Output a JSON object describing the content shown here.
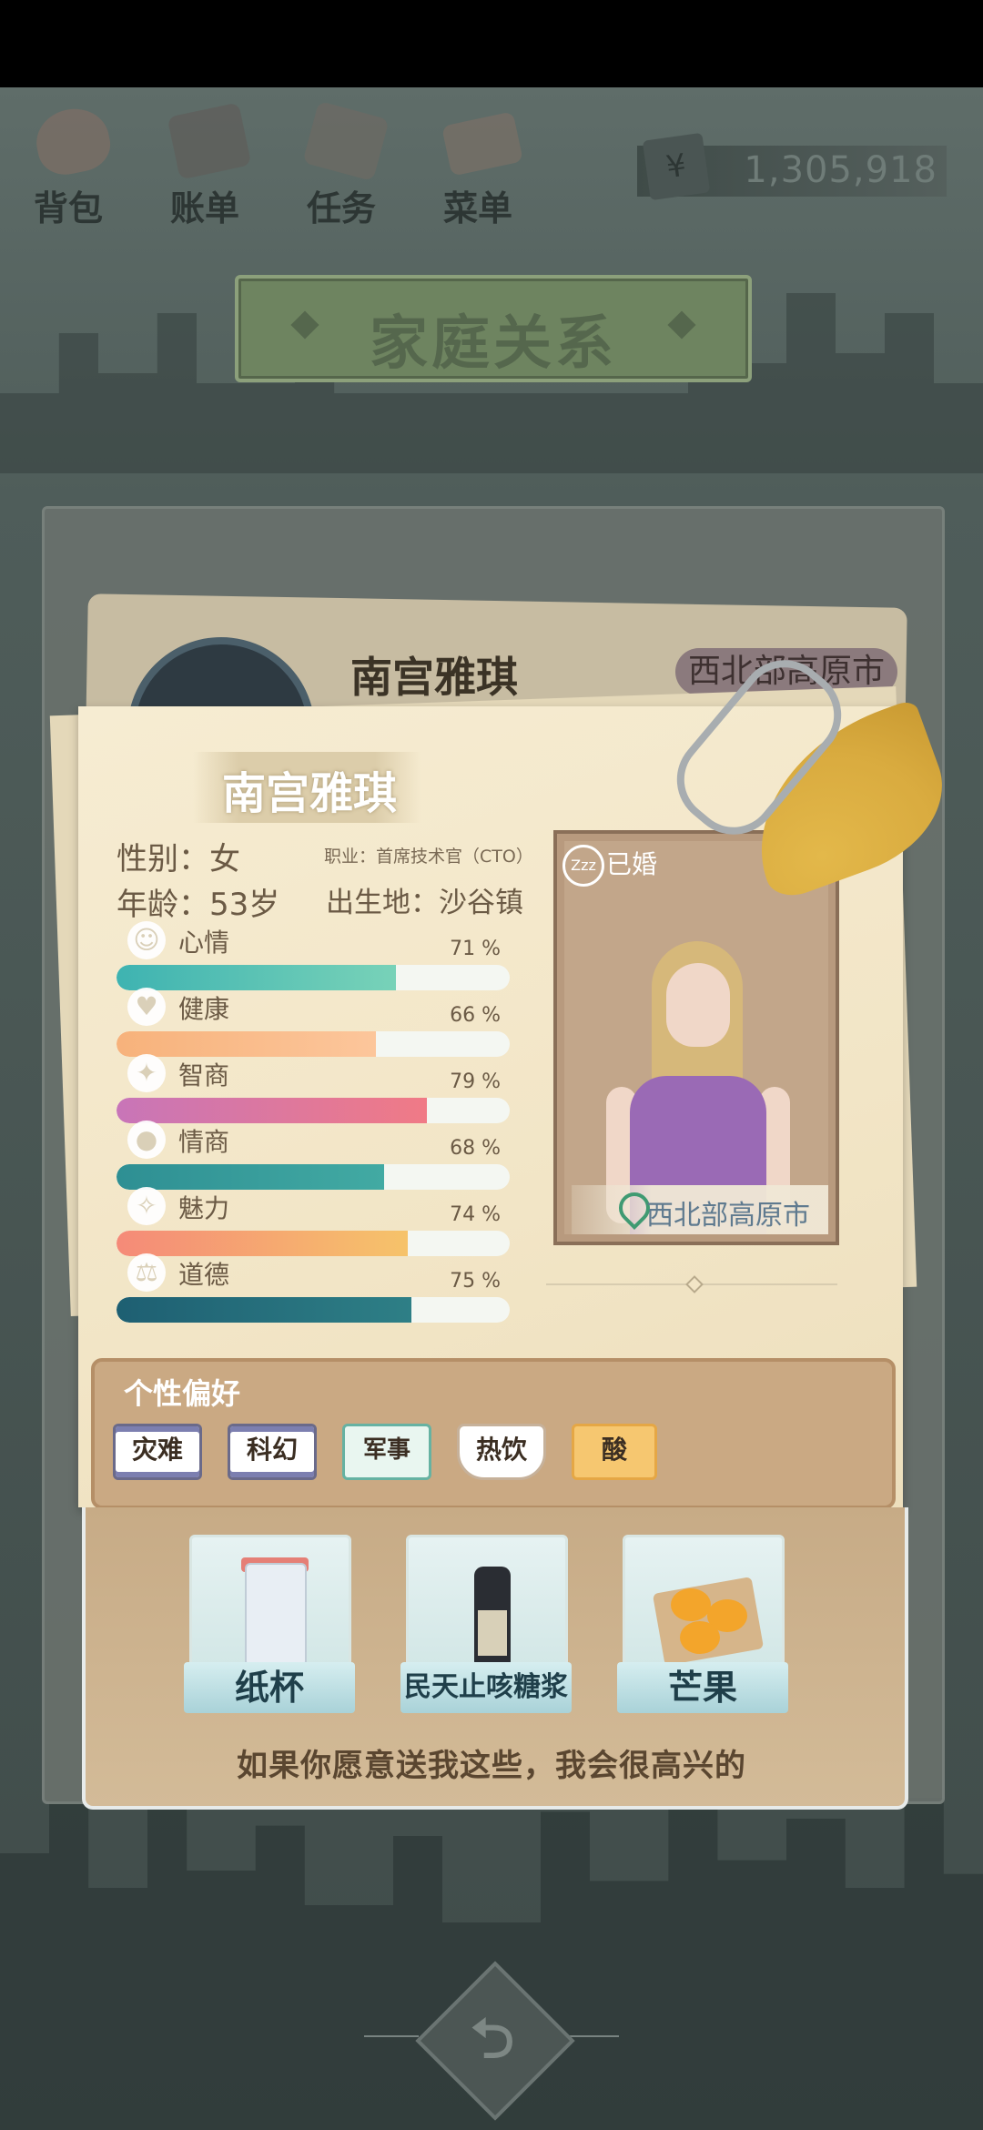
{
  "nav": {
    "items": [
      {
        "label": "背包",
        "icon": "backpack-icon"
      },
      {
        "label": "账单",
        "icon": "bill-icon"
      },
      {
        "label": "任务",
        "icon": "task-icon"
      },
      {
        "label": "菜单",
        "icon": "menu-icon"
      }
    ],
    "money_symbol": "¥",
    "money": "1,305,918"
  },
  "title": "家庭关系",
  "background_card": {
    "name": "南宫雅琪",
    "location": "西北部高原市"
  },
  "profile": {
    "name": "南宫雅琪",
    "gender": "性别：女",
    "job": "职业：首席技术官（CTO）",
    "age": "年龄：53岁",
    "birthplace": "出生地：沙谷镇",
    "marital_status": "已婚",
    "sleep_badge": "Zzz",
    "location": "西北部高原市"
  },
  "stats": [
    {
      "label": "心情",
      "pct_text": "71 %",
      "value": 0.71,
      "icon": "smile-icon",
      "glyph": "☺",
      "color": [
        "#3eb3b1",
        "#78d2b8"
      ]
    },
    {
      "label": "健康",
      "pct_text": "66 %",
      "value": 0.66,
      "icon": "heart-icon",
      "glyph": "♥",
      "color": [
        "#f7b27b",
        "#fcc69b"
      ]
    },
    {
      "label": "智商",
      "pct_text": "79 %",
      "value": 0.79,
      "icon": "bulb-icon",
      "glyph": "✦",
      "color": [
        "#c875b8",
        "#f07a86"
      ]
    },
    {
      "label": "情商",
      "pct_text": "68 %",
      "value": 0.68,
      "icon": "apple-icon",
      "glyph": "●",
      "color": [
        "#2e8f93",
        "#42aaa3"
      ]
    },
    {
      "label": "魅力",
      "pct_text": "74 %",
      "value": 0.74,
      "icon": "sparkle-icon",
      "glyph": "✧",
      "color": [
        "#f58a78",
        "#f6c36a"
      ]
    },
    {
      "label": "道德",
      "pct_text": "75 %",
      "value": 0.75,
      "icon": "scale-icon",
      "glyph": "⚖",
      "color": [
        "#1e5f72",
        "#2e7f86"
      ]
    }
  ],
  "preferences": {
    "title": "个性偏好",
    "tags": [
      "灾难",
      "科幻",
      "军事",
      "热饮",
      "酸"
    ]
  },
  "gifts": {
    "items": [
      {
        "label": "纸杯",
        "qty": "1"
      },
      {
        "label": "民天止咳糖浆",
        "qty": "1"
      },
      {
        "label": "芒果",
        "qty": "1"
      }
    ],
    "hint": "如果你愿意送我这些，我会很高兴的"
  },
  "back_button_glyph": "⮌"
}
